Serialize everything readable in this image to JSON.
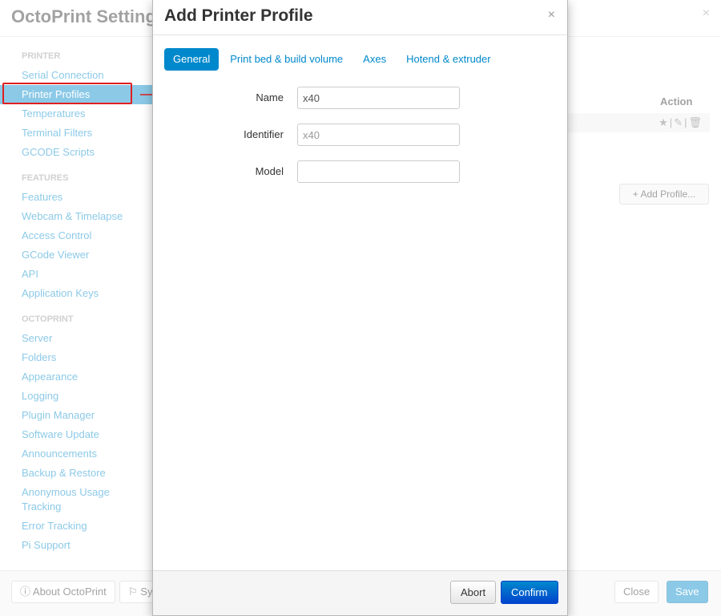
{
  "background": {
    "title": "OctoPrint Settings",
    "sidebar": {
      "sections": [
        {
          "heading": "PRINTER",
          "items": [
            "Serial Connection",
            "Printer Profiles",
            "Temperatures",
            "Terminal Filters",
            "GCODE Scripts"
          ]
        },
        {
          "heading": "FEATURES",
          "items": [
            "Features",
            "Webcam & Timelapse",
            "Access Control",
            "GCode Viewer",
            "API",
            "Application Keys"
          ]
        },
        {
          "heading": "OCTOPRINT",
          "items": [
            "Server",
            "Folders",
            "Appearance",
            "Logging",
            "Plugin Manager",
            "Software Update",
            "Announcements",
            "Backup & Restore",
            "Anonymous Usage Tracking",
            "Error Tracking",
            "Pi Support"
          ]
        }
      ],
      "active_item": "Printer Profiles"
    },
    "profiles_table": {
      "action_header": "Action"
    },
    "add_profile_label": "+ Add Profile...",
    "footer": {
      "about_label": "About OctoPrint",
      "system_label": "Sy",
      "close_label": "Close",
      "save_label": "Save"
    }
  },
  "modal": {
    "title": "Add Printer Profile",
    "close_glyph": "×",
    "tabs": [
      "General",
      "Print bed & build volume",
      "Axes",
      "Hotend & extruder"
    ],
    "active_tab": "General",
    "fields": {
      "name": {
        "label": "Name",
        "value": "x40"
      },
      "identifier": {
        "label": "Identifier",
        "placeholder": "x40"
      },
      "model": {
        "label": "Model",
        "value": ""
      }
    },
    "footer": {
      "abort_label": "Abort",
      "confirm_label": "Confirm"
    }
  },
  "colors": {
    "accent": "#0088cc",
    "annotation": "#e02020"
  }
}
